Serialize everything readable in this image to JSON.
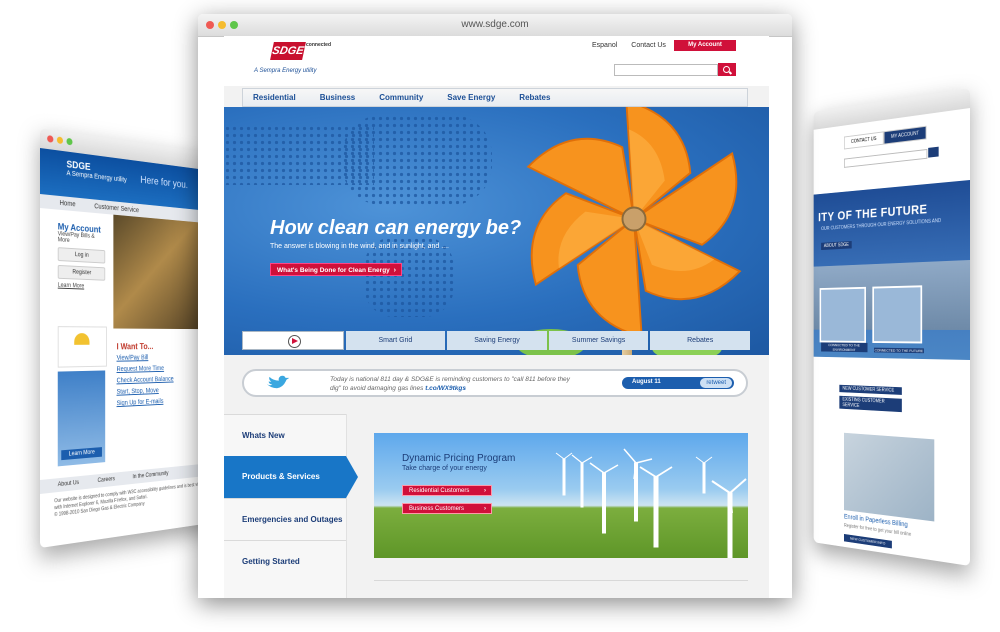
{
  "left_window": {
    "logo": "SDGE",
    "sempra": "A Sempra Energy utility",
    "tagline": "Here for you.",
    "nav": [
      "Home",
      "Customer Service"
    ],
    "account_title": "My Account",
    "account_sub": "View/Pay Bills & More",
    "login": "Log in",
    "register": "Register",
    "learn_more_link": "Learn More",
    "learn_more_btn": "Learn More",
    "iwant_title": "I Want To...",
    "iwant_items": [
      "View/Pay Bill",
      "Request More Time",
      "Check Account Balance",
      "Start, Stop, Move",
      "Sign Up for E-mails"
    ],
    "footer_nav": [
      "About Us",
      "Careers",
      "In the Community"
    ],
    "footer_text": "Our website is designed to comply with W3C accessibility guidelines and is best viewed with Internet Explorer 6, Mozilla Firefox, and Safari.",
    "copyright": "© 1998-2010 San Diego Gas & Electric Company"
  },
  "right_window": {
    "tabs": [
      "CONTACT US",
      "MY ACCOUNT"
    ],
    "hero_title": "ITY OF THE FUTURE",
    "hero_sub": "OUR CUSTOMERS THROUGH OUR ENERGY SOLUTIONS AND",
    "hero_btn": "ABOUT SDGE",
    "thumb1": "CONNECTED TO THE ENVIRONMENT",
    "thumb2": "CONNECTED TO THE FUTURE",
    "links": [
      "NEW CUSTOMER SERVICE",
      "EXISTING CUSTOMER SERVICE"
    ],
    "photo_caption": "Enroll in Paperless Billing",
    "photo_sub": "Register for free to get your bill online",
    "photo_btn": "NEW CUSTOMER INFO"
  },
  "main": {
    "url": "www.sdge.com",
    "logo": "SDGE",
    "logo_connected": "connected",
    "sempra": "A Sempra Energy utility",
    "header_links": [
      "Espanol",
      "Contact Us"
    ],
    "account_button": "My Account",
    "nav": [
      "Residential",
      "Business",
      "Community",
      "Save Energy",
      "Rebates"
    ],
    "hero": {
      "title": "How clean can energy be?",
      "subtitle": "The answer is blowing in the wind, and in sunlight, and ....",
      "cta": "What's Being Done for Clean Energy"
    },
    "tabs": [
      "Smart Grid",
      "Saving Energy",
      "Summer Savings",
      "Rebates"
    ],
    "twitter": {
      "text": "Today is national 811 day & SDG&E is reminding customers to \"call 811 before they dig\" to avoid damaging gas lines",
      "link": "t.co/WX9tkgs",
      "date": "August 11",
      "retweet": "retweet"
    },
    "sidebar": [
      "Whats New",
      "Products & Services",
      "Emergencies and Outages",
      "Getting Started"
    ],
    "promo": {
      "title": "Dynamic Pricing Program",
      "subtitle": "Take charge of your energy",
      "buttons": [
        "Residential Customers",
        "Business Customers"
      ]
    }
  },
  "colors": {
    "accent_red": "#d0103a",
    "brand_blue": "#1c4f96",
    "active_blue": "#1876c7"
  }
}
